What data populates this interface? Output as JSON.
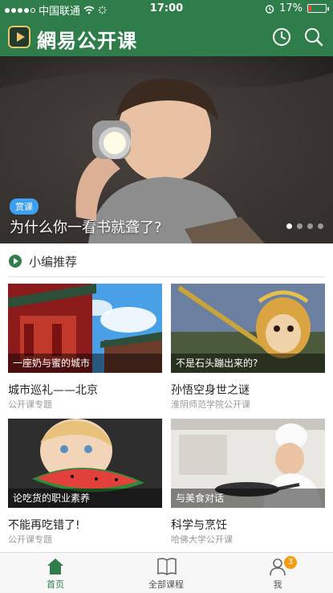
{
  "status": {
    "carrier": "中国联通",
    "time": "17:00",
    "battery": "17%",
    "battery_level": 0.17,
    "signal_dots_filled": 4
  },
  "header": {
    "app_title": "網易公开课",
    "icons": [
      "history-icon",
      "search-icon"
    ],
    "color": "#2e7d4a"
  },
  "banner": {
    "badge": "赏课",
    "title": "为什么你一看书就聋了?",
    "pages": 4,
    "active_page": 0,
    "badge_color": "#3ea0f2"
  },
  "section": {
    "title": "小编推荐"
  },
  "cards": [
    {
      "caption": "一座奶与蜜的城市",
      "title": "城市巡礼——北京",
      "subtitle": "公开课专题"
    },
    {
      "caption": "不是石头蹦出来的?",
      "title": "孙悟空身世之谜",
      "subtitle": "淮阴师范学院公开课"
    },
    {
      "caption": "论吃货的职业素养",
      "title": "不能再吃错了!",
      "subtitle": "公开课专题"
    },
    {
      "caption": "与美食对话",
      "title": "科学与烹饪",
      "subtitle": "哈佛大学公开课"
    }
  ],
  "tabs": [
    {
      "label": "首页",
      "icon": "home-icon"
    },
    {
      "label": "全部课程",
      "icon": "book-icon"
    },
    {
      "label": "我",
      "icon": "user-icon",
      "badge": "3"
    }
  ]
}
